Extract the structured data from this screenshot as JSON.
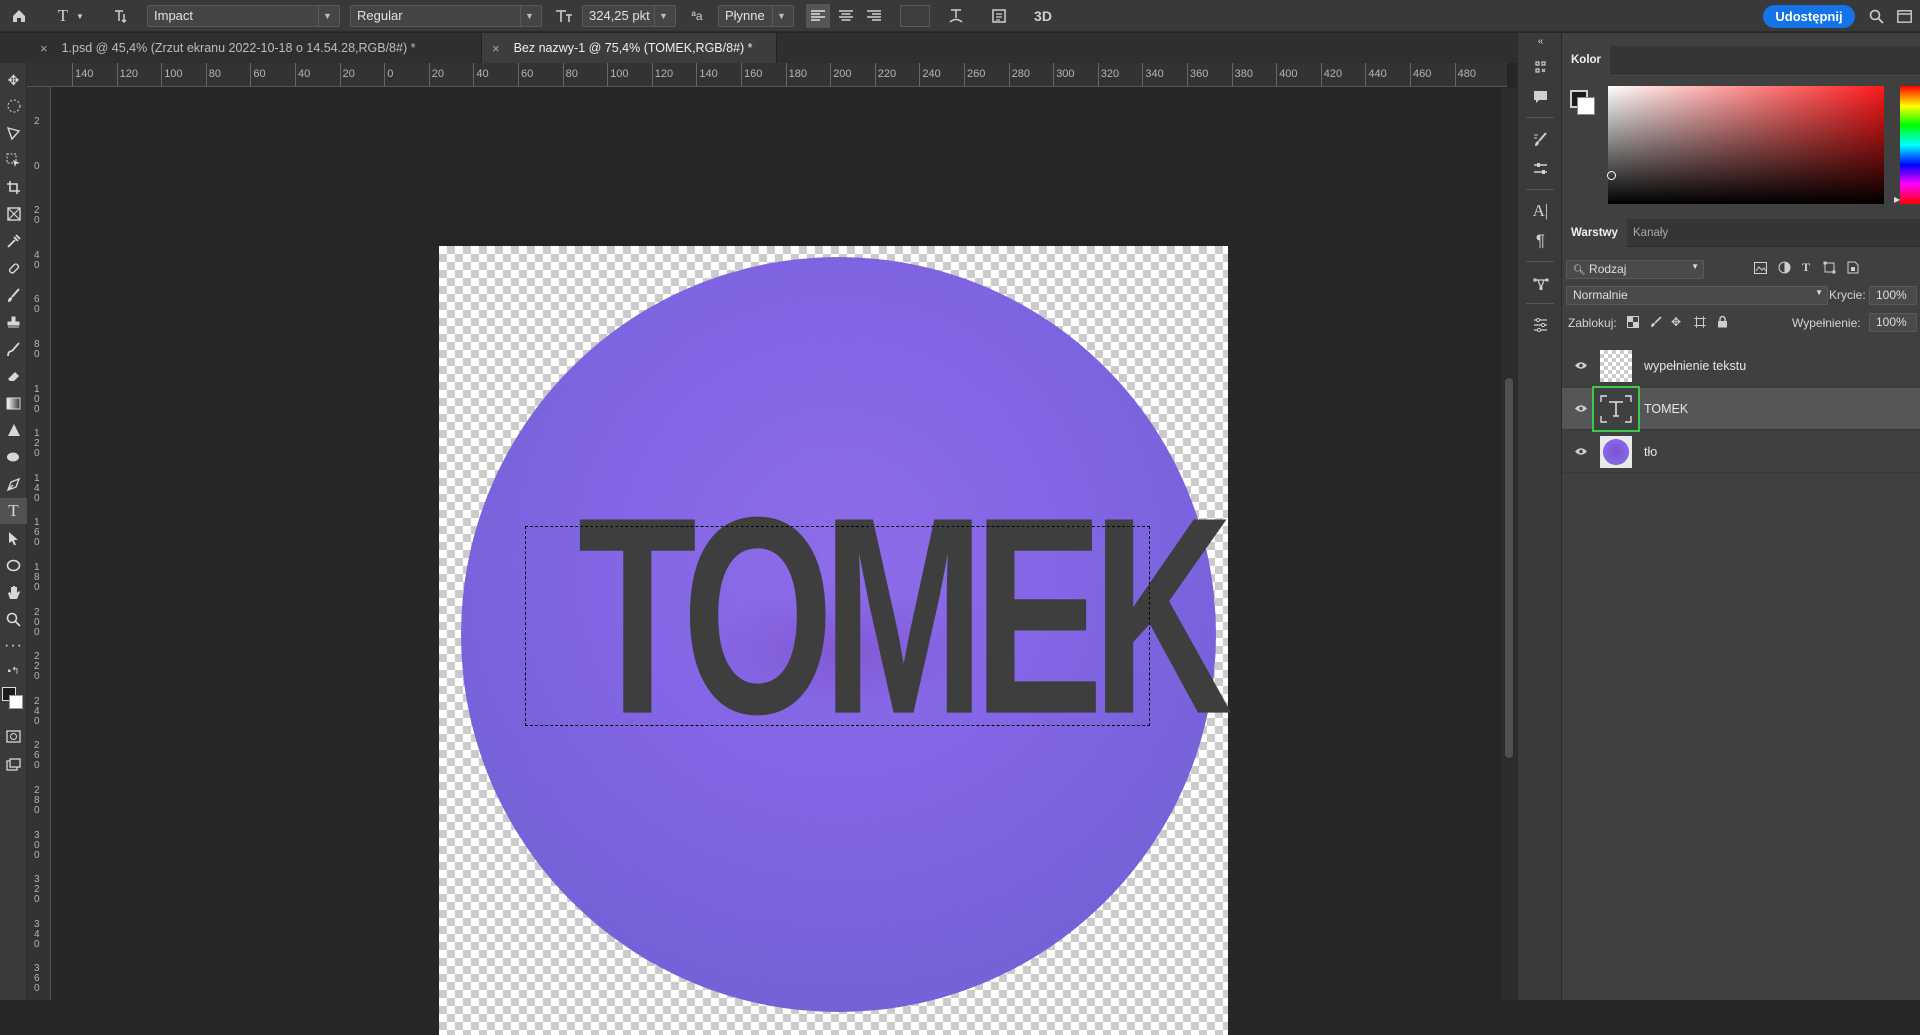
{
  "options_bar": {
    "tool_glyph": "T",
    "font_family": "Impact",
    "font_style": "Regular",
    "font_size": "324,25 pkt",
    "aa_glyph": "ªa",
    "antialias": "Płynne",
    "three_d": "3D",
    "share": "Udostępnij"
  },
  "tabs": [
    {
      "label": "1.psd @ 45,4% (Zrzut ekranu 2022-10-18 o 14.54.28,RGB/8#) *",
      "active": false
    },
    {
      "label": "Bez nazwy-1 @ 75,4% (TOMEK,RGB/8#) *",
      "active": true
    }
  ],
  "ruler_top": [
    "140",
    "120",
    "100",
    "80",
    "60",
    "40",
    "20",
    "0",
    "20",
    "40",
    "60",
    "80",
    "100",
    "120",
    "140",
    "160",
    "180",
    "200",
    "220",
    "240",
    "260",
    "280",
    "300",
    "320",
    "340",
    "360",
    "380",
    "400",
    "420",
    "440",
    "460",
    "480"
  ],
  "ruler_left": [
    "2",
    "0",
    "2 0",
    "4 0",
    "6 0",
    "8 0",
    "1 0 0",
    "1 2 0",
    "1 4 0",
    "1 6 0",
    "1 8 0",
    "2 0 0",
    "2 2 0",
    "2 4 0",
    "2 6 0",
    "2 8 0",
    "3 0 0",
    "3 2 0",
    "3 4 0",
    "3 6 0"
  ],
  "canvas": {
    "text_layer_content": "TOMEK",
    "circle_color": "#8466e6",
    "text_color": "#3e3e3e"
  },
  "panels": {
    "color_tab": "Kolor",
    "layers_tab": "Warstwy",
    "channels_tab": "Kanały",
    "filter_kind": "Rodzaj",
    "blend_mode": "Normalnie",
    "opacity_label": "Krycie:",
    "opacity_value": "100%",
    "lock_label": "Zablokuj:",
    "fill_label": "Wypełnienie:",
    "fill_value": "100%"
  },
  "layers": [
    {
      "name": "wypełnienie tekstu",
      "type": "empty",
      "selected": false
    },
    {
      "name": "TOMEK",
      "type": "text",
      "selected": true
    },
    {
      "name": "tło",
      "type": "circle",
      "selected": false
    }
  ],
  "colors": {
    "accent": "#1473e6",
    "highlight": "#3cc84a"
  }
}
